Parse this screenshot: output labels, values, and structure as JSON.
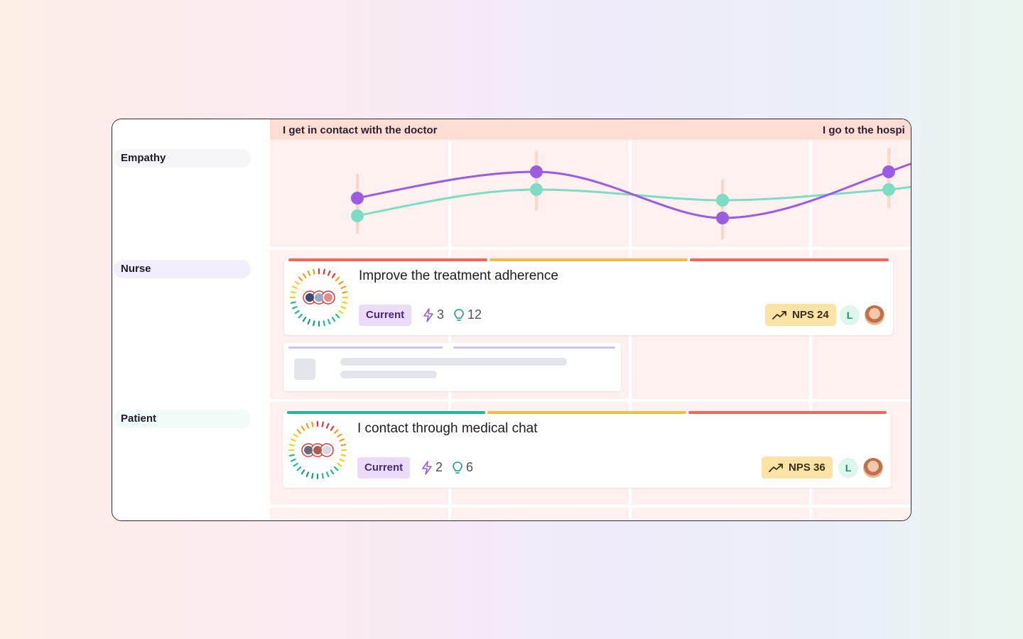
{
  "stages": [
    "I get in contact with the doctor",
    "I go to the hospi"
  ],
  "lanes": [
    {
      "label": "Empathy",
      "bg": "#f5f5f7"
    },
    {
      "label": "Nurse",
      "bg": "#f3eefc"
    },
    {
      "label": "Patient",
      "bg": "#f1fbf8"
    }
  ],
  "cards": [
    {
      "title": "Improve the treatment adherence",
      "tag": "Current",
      "pains": "3",
      "ideas": "12",
      "nps": "NPS 24",
      "assignee": "L",
      "bars": [
        "#f0665a",
        "#e8bf4a",
        "#f0665a"
      ]
    },
    {
      "title": "I contact through medical chat",
      "tag": "Current",
      "pains": "2",
      "ideas": "6",
      "nps": "NPS 36",
      "assignee": "L",
      "bars": [
        "#22b894",
        "#e8bf4a",
        "#f0665a"
      ]
    }
  ],
  "colors": {
    "purple": "#9b5ce0",
    "teal": "#7fdcc4",
    "stage_bg": "#ffdcd4",
    "grid_bg": "#fff1ef",
    "skeleton_bar": "#d6bdf2"
  },
  "icons": {
    "pain": "lightning-icon",
    "idea": "lightbulb-icon",
    "trend": "trend-up-icon"
  }
}
